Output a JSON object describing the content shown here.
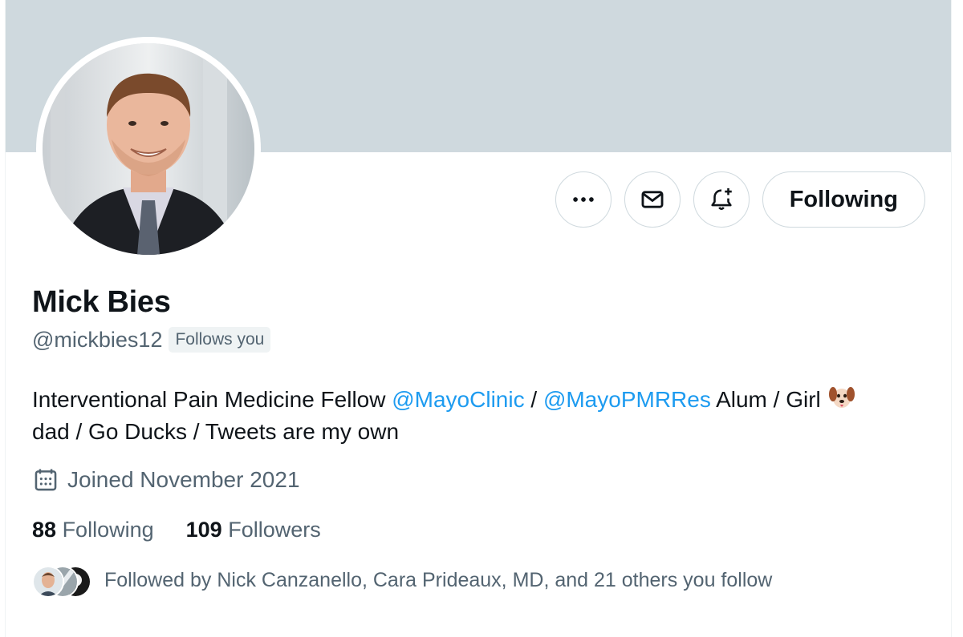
{
  "profile": {
    "name": "Mick Bies",
    "handle": "@mickbies12",
    "follows_you_badge": "Follows you",
    "bio": {
      "text_1": "Interventional Pain Medicine Fellow ",
      "mention_1": "@MayoClinic",
      "text_2": " / ",
      "mention_2": "@MayoPMRRes",
      "text_3": " Alum / Girl ",
      "text_4": "dad / Go Ducks / Tweets are my own"
    },
    "joined": "Joined November 2021",
    "stats": {
      "following_count": "88",
      "following_label": "Following",
      "followers_count": "109",
      "followers_label": "Followers"
    },
    "followed_by": "Followed by Nick Canzanello, Cara Prideaux, MD, and 21 others you follow"
  },
  "actions": {
    "more_icon": "more-dots-icon",
    "message_icon": "mail-icon",
    "notify_icon": "bell-plus-icon",
    "following_button": "Following"
  },
  "colors": {
    "banner": "#cfd9de",
    "link": "#1d9bf0",
    "secondary_text": "#536471",
    "primary_text": "#0f1419"
  }
}
